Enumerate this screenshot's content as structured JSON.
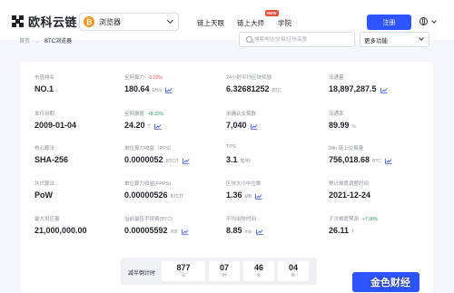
{
  "header": {
    "logo_text": "欧科云链",
    "chain_select": "浏览器",
    "chain_icon": "₿",
    "nav": [
      "链上天眼",
      "链上大师",
      "学院"
    ],
    "new_badge": "NEW",
    "signup": "注册"
  },
  "breadcrumb": {
    "home": "首页",
    "sep": "→",
    "current": "BTC浏览器"
  },
  "search": {
    "placeholder": "搜索地址/交易/区块高度"
  },
  "more_menu": "更多功能",
  "stats": [
    {
      "label": "市值排名",
      "value": "NO.1",
      "unit": "",
      "change": "",
      "trend": false
    },
    {
      "label": "全网算力",
      "value": "180.64",
      "unit": "EH/s",
      "change": "-0.22%",
      "change_dir": "down",
      "trend": true
    },
    {
      "label": "24小时平均区块奖励",
      "value": "6.32681252",
      "unit": "BTC",
      "change": "",
      "trend": false
    },
    {
      "label": "流通量",
      "value": "18,897,287.5",
      "unit": "",
      "change": "",
      "trend": true
    },
    {
      "label": "发行日期",
      "value": "2009-01-04",
      "unit": "",
      "change": "",
      "trend": false
    },
    {
      "label": "全网难度",
      "value": "24.20",
      "unit": "T",
      "change": "+8.33%",
      "change_dir": "up",
      "trend": true
    },
    {
      "label": "未确认交易数",
      "value": "7,040",
      "unit": "",
      "change": "",
      "trend": true
    },
    {
      "label": "流通率",
      "value": "89.99",
      "unit": "%",
      "change": "",
      "trend": false
    },
    {
      "label": "核心算法",
      "value": "SHA-256",
      "unit": "",
      "change": "",
      "trend": false
    },
    {
      "label": "单位算力收益（PPS）",
      "value": "0.0000052",
      "unit": "BTC/T",
      "change": "",
      "trend": true
    },
    {
      "label": "TPS",
      "value": "3.1",
      "unit": "笔/秒",
      "change": "",
      "trend": false
    },
    {
      "label": "24h 链上交易量",
      "value": "756,018.68",
      "unit": "BTC",
      "change": "",
      "trend": true
    },
    {
      "label": "共识算法",
      "value": "PoW",
      "unit": "",
      "change": "",
      "trend": false
    },
    {
      "label": "单位算力收益(FPPS)",
      "value": "0.00000526",
      "unit": "BTC/T",
      "change": "",
      "trend": false
    },
    {
      "label": "区块大小中位数",
      "value": "1.36",
      "unit": "MB",
      "change": "",
      "trend": true
    },
    {
      "label": "预计难度调整时间",
      "value": "2021-12-24",
      "unit": "",
      "change": "",
      "trend": false
    },
    {
      "label": "最大供应量",
      "value": "21,000,000.00",
      "unit": "",
      "change": "",
      "trend": false
    },
    {
      "label": "当前最佳手续费(BTC)",
      "value": "0.00005592",
      "unit": "/KB",
      "change": "",
      "trend": true
    },
    {
      "label": "平均出块时间",
      "value": "8.85",
      "unit": "min",
      "change": "",
      "trend": true
    },
    {
      "label": "下次难度预测",
      "value": "26.11",
      "unit": "T",
      "change": "+7.90%",
      "change_dir": "up",
      "trend": false
    }
  ],
  "countdown": {
    "label": "减半倒计时",
    "boxes": [
      {
        "n": "877",
        "u": "天"
      },
      {
        "n": "07",
        "u": "时"
      },
      {
        "n": "46",
        "u": "分"
      },
      {
        "n": "04",
        "u": "秒"
      }
    ]
  },
  "watermark": "金色财经",
  "colors": {
    "accent": "#2d54ff",
    "up": "#22a35a",
    "down": "#e5484d",
    "btc": "#f7931a"
  }
}
